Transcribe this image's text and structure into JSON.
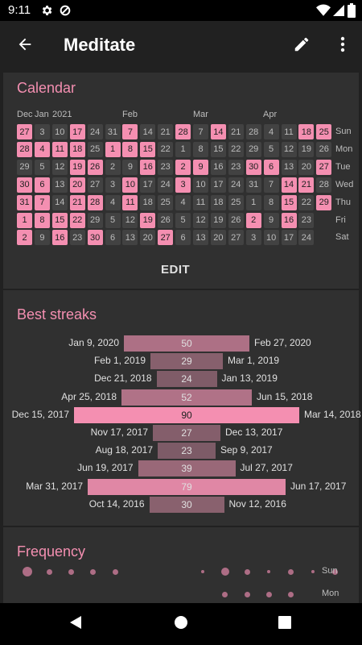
{
  "status": {
    "time": "9:11"
  },
  "appbar": {
    "title": "Meditate",
    "back_icon": "arrow-back-icon",
    "edit_icon": "pencil-icon",
    "more_icon": "more-vert-icon"
  },
  "calendar": {
    "title": "Calendar",
    "month_labels": [
      "Dec",
      "Jan",
      "2021",
      "Feb",
      "Mar",
      "Apr"
    ],
    "weekdays": [
      "Sun",
      "Mon",
      "Tue",
      "Wed",
      "Thu",
      "Fri",
      "Sat"
    ],
    "columns": [
      [
        [
          "27",
          1
        ],
        [
          "28",
          1
        ],
        [
          "29",
          0
        ],
        [
          "30",
          1
        ],
        [
          "31",
          1
        ],
        [
          "1",
          1
        ],
        [
          "2",
          1
        ]
      ],
      [
        [
          "3",
          0
        ],
        [
          "4",
          1
        ],
        [
          "5",
          0
        ],
        [
          "6",
          1
        ],
        [
          "7",
          1
        ],
        [
          "8",
          1
        ],
        [
          "9",
          0
        ]
      ],
      [
        [
          "10",
          0
        ],
        [
          "11",
          1
        ],
        [
          "12",
          0
        ],
        [
          "13",
          0
        ],
        [
          "14",
          0
        ],
        [
          "15",
          1
        ],
        [
          "16",
          1
        ]
      ],
      [
        [
          "17",
          1
        ],
        [
          "18",
          1
        ],
        [
          "19",
          1
        ],
        [
          "20",
          1
        ],
        [
          "21",
          1
        ],
        [
          "22",
          1
        ],
        [
          "23",
          0
        ]
      ],
      [
        [
          "24",
          0
        ],
        [
          "25",
          0
        ],
        [
          "26",
          1
        ],
        [
          "27",
          0
        ],
        [
          "28",
          1
        ],
        [
          "29",
          0
        ],
        [
          "30",
          1
        ]
      ],
      [
        [
          "31",
          0
        ],
        [
          "1",
          1
        ],
        [
          "2",
          0
        ],
        [
          "3",
          0
        ],
        [
          "4",
          0
        ],
        [
          "5",
          0
        ],
        [
          "6",
          0
        ]
      ],
      [
        [
          "7",
          1
        ],
        [
          "8",
          1
        ],
        [
          "9",
          0
        ],
        [
          "10",
          1
        ],
        [
          "11",
          1
        ],
        [
          "12",
          0
        ],
        [
          "13",
          0
        ]
      ],
      [
        [
          "14",
          0
        ],
        [
          "15",
          1
        ],
        [
          "16",
          1
        ],
        [
          "17",
          0
        ],
        [
          "18",
          0
        ],
        [
          "19",
          1
        ],
        [
          "20",
          0
        ]
      ],
      [
        [
          "21",
          0
        ],
        [
          "22",
          0
        ],
        [
          "23",
          0
        ],
        [
          "24",
          0
        ],
        [
          "25",
          0
        ],
        [
          "26",
          0
        ],
        [
          "27",
          1
        ]
      ],
      [
        [
          "28",
          1
        ],
        [
          "1",
          0
        ],
        [
          "2",
          1
        ],
        [
          "3",
          1
        ],
        [
          "4",
          0
        ],
        [
          "5",
          0
        ],
        [
          "6",
          0
        ]
      ],
      [
        [
          "7",
          0
        ],
        [
          "8",
          0
        ],
        [
          "9",
          1
        ],
        [
          "10",
          0
        ],
        [
          "11",
          0
        ],
        [
          "12",
          0
        ],
        [
          "13",
          0
        ]
      ],
      [
        [
          "14",
          1
        ],
        [
          "15",
          0
        ],
        [
          "16",
          0
        ],
        [
          "17",
          0
        ],
        [
          "18",
          0
        ],
        [
          "19",
          0
        ],
        [
          "20",
          0
        ]
      ],
      [
        [
          "21",
          0
        ],
        [
          "22",
          0
        ],
        [
          "23",
          0
        ],
        [
          "24",
          0
        ],
        [
          "25",
          0
        ],
        [
          "26",
          0
        ],
        [
          "27",
          0
        ]
      ],
      [
        [
          "28",
          0
        ],
        [
          "29",
          0
        ],
        [
          "30",
          1
        ],
        [
          "31",
          0
        ],
        [
          "1",
          0
        ],
        [
          "2",
          1
        ],
        [
          "3",
          0
        ]
      ],
      [
        [
          "4",
          0
        ],
        [
          "5",
          0
        ],
        [
          "6",
          1
        ],
        [
          "7",
          0
        ],
        [
          "8",
          0
        ],
        [
          "9",
          0
        ],
        [
          "10",
          0
        ]
      ],
      [
        [
          "11",
          0
        ],
        [
          "12",
          0
        ],
        [
          "13",
          0
        ],
        [
          "14",
          1
        ],
        [
          "15",
          1
        ],
        [
          "16",
          1
        ],
        [
          "17",
          0
        ]
      ],
      [
        [
          "18",
          1
        ],
        [
          "19",
          0
        ],
        [
          "20",
          0
        ],
        [
          "21",
          1
        ],
        [
          "22",
          0
        ],
        [
          "23",
          0
        ],
        [
          "24",
          0
        ]
      ],
      [
        [
          "25",
          1
        ],
        [
          "26",
          0
        ],
        [
          "27",
          1
        ],
        [
          "28",
          0
        ],
        [
          "29",
          1
        ],
        null,
        null
      ]
    ],
    "edit_label": "EDIT"
  },
  "streaks": {
    "title": "Best streaks",
    "rows": [
      {
        "start": "Jan 9, 2020",
        "length": "50",
        "end": "Feb 27, 2020"
      },
      {
        "start": "Feb 1, 2019",
        "length": "29",
        "end": "Mar 1, 2019"
      },
      {
        "start": "Dec 21, 2018",
        "length": "24",
        "end": "Jan 13, 2019"
      },
      {
        "start": "Apr 25, 2018",
        "length": "52",
        "end": "Jun 15, 2018"
      },
      {
        "start": "Dec 15, 2017",
        "length": "90",
        "end": "Mar 14, 2018"
      },
      {
        "start": "Nov 17, 2017",
        "length": "27",
        "end": "Dec 13, 2017"
      },
      {
        "start": "Aug 18, 2017",
        "length": "23",
        "end": "Sep 9, 2017"
      },
      {
        "start": "Jun 19, 2017",
        "length": "39",
        "end": "Jul 27, 2017"
      },
      {
        "start": "Mar 31, 2017",
        "length": "79",
        "end": "Jun 17, 2017"
      },
      {
        "start": "Oct 14, 2016",
        "length": "30",
        "end": "Nov 12, 2016"
      }
    ]
  },
  "frequency": {
    "title": "Frequency",
    "rows": [
      {
        "label": "Sun",
        "dots": [
          3,
          1,
          1,
          1,
          1,
          0,
          0,
          0,
          0.5,
          2,
          1,
          0.5,
          1,
          0.5,
          1
        ]
      },
      {
        "label": "Mon",
        "dots": [
          0,
          0,
          0,
          0,
          0,
          0,
          0,
          0,
          0,
          1,
          1,
          1,
          1,
          0,
          0
        ]
      }
    ]
  },
  "colors": {
    "accent": "#f48fb1",
    "card": "#303030",
    "background": "#212121"
  }
}
